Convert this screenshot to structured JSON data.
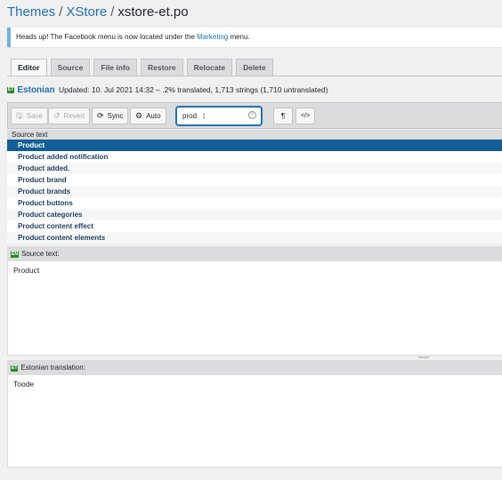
{
  "breadcrumb": {
    "items": [
      "Themes",
      "XStore"
    ],
    "separator": "/",
    "current": "xstore-et.po"
  },
  "notice": {
    "text_before": "Heads up! The Facebook menu is now located under the ",
    "link": "Marketing",
    "text_after": " menu."
  },
  "tabs": [
    "Editor",
    "Source",
    "File info",
    "Restore",
    "Relocate",
    "Delete"
  ],
  "status": {
    "flag_code": "ET",
    "language": "Estonian",
    "summary": "Updated: 10. Jul 2021 14:32 – .2% translated, 1,713 strings (1,710 untranslated)"
  },
  "toolbar": {
    "save_label": "Save",
    "revert_label": "Revert",
    "sync_label": "Sync",
    "auto_label": "Auto",
    "search_value": "prod",
    "pilcrow": "¶",
    "code_toggle": "</>"
  },
  "list": {
    "header": "Source text",
    "items": [
      "Product",
      "Product added notification",
      "Product added.",
      "Product brand",
      "Product brands",
      "Product buttons",
      "Product categories",
      "Product content effect",
      "Product content elements"
    ],
    "selected_index": 0
  },
  "source_pane": {
    "flag_code": "EN",
    "label": "Source text:",
    "text": "Product"
  },
  "translation_pane": {
    "flag_code": "ET",
    "label": "Estonian translation:",
    "text": "Toode"
  },
  "colors": {
    "accent": "#2271b1",
    "selected_row": "#135e96",
    "flag_green": "#2a8a2a"
  }
}
